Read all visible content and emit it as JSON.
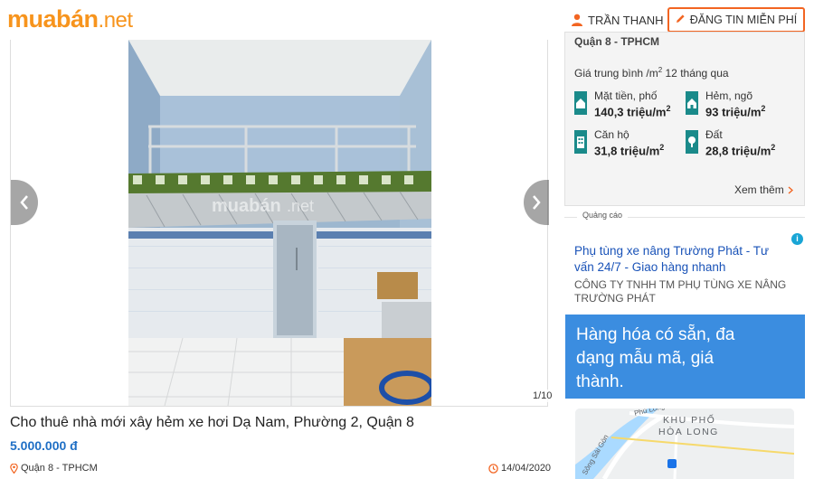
{
  "header": {
    "logo_main": "muabán",
    "logo_suffix": ".net",
    "user_name": "TRẦN THANH",
    "post_button": "ĐĂNG TIN MIỄN PHÍ"
  },
  "gallery": {
    "counter": "1/10",
    "watermark_main": "muabán",
    "watermark_suffix": ".net"
  },
  "listing": {
    "title": "Cho thuê nhà mới xây hẻm xe hơi Dạ Nam, Phường 2, Quận 8",
    "price": "5.000.000 đ",
    "location": "Quận 8 - TPHCM",
    "date": "14/04/2020"
  },
  "price_widget": {
    "heading": "Quận 8 - TPHCM",
    "subtitle_prefix": "Giá trung bình /m",
    "subtitle_sup": "2",
    "subtitle_suffix": " 12 tháng qua",
    "items": [
      {
        "label": "Mặt tiền, phố",
        "value": "140,3 triệu/m",
        "icon": "storefront-icon"
      },
      {
        "label": "Hẻm, ngõ",
        "value": "93 triệu/m",
        "icon": "alley-house-icon"
      },
      {
        "label": "Căn hộ",
        "value": "31,8 triệu/m",
        "icon": "apartment-icon"
      },
      {
        "label": "Đất",
        "value": "28,8 triệu/m",
        "icon": "land-icon"
      }
    ],
    "unit_sup": "2",
    "see_more": "Xem thêm"
  },
  "ad": {
    "label": "Quảng cáo",
    "title": "Phụ tùng xe nâng Trường Phát - Tư vấn 24/7 - Giao hàng nhanh",
    "company": "CÔNG TY TNHH TM PHỤ TÙNG XE NÂNG TRƯỜNG PHÁT",
    "banner": "Hàng hóa có sẵn, đa dạng mẫu mã, giá thành.",
    "map_area_1": "KHU PHỐ",
    "map_area_2": "HÒA LONG",
    "map_street_1": "Phú Long",
    "map_street_2": "Sông Sài Gòn"
  },
  "colors": {
    "brand_orange": "#f7941d",
    "price_blue": "#1f6fc5",
    "icon_teal": "#1a8a8a",
    "ad_blue": "#3b8de0"
  }
}
